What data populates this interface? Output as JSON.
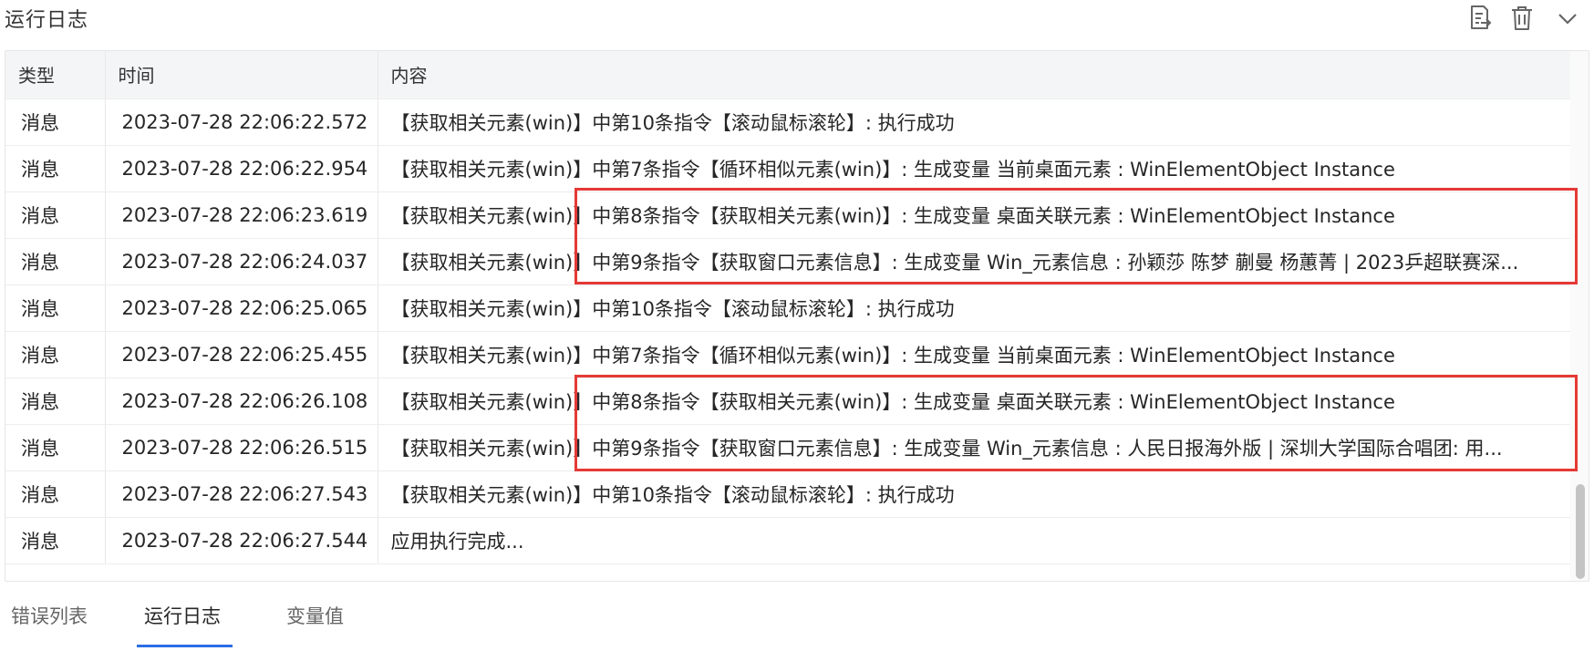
{
  "panel": {
    "title": "运行日志",
    "icons": {
      "export": "export-log-icon",
      "delete": "trash-icon",
      "collapse": "chevron-down-icon"
    }
  },
  "table": {
    "headers": {
      "type": "类型",
      "time": "时间",
      "content": "内容"
    },
    "rows": [
      {
        "type": "消息",
        "time": "2023-07-28 22:06:22.572",
        "content": "【获取相关元素(win)】中第10条指令【滚动鼠标滚轮】: 执行成功"
      },
      {
        "type": "消息",
        "time": "2023-07-28 22:06:22.954",
        "content": "【获取相关元素(win)】中第7条指令【循环相似元素(win)】: 生成变量 当前桌面元素 : WinElementObject Instance"
      },
      {
        "type": "消息",
        "time": "2023-07-28 22:06:23.619",
        "content": "【获取相关元素(win)】中第8条指令【获取相关元素(win)】: 生成变量 桌面关联元素 : WinElementObject Instance"
      },
      {
        "type": "消息",
        "time": "2023-07-28 22:06:24.037",
        "content": "【获取相关元素(win)】中第9条指令【获取窗口元素信息】: 生成变量 Win_元素信息 : 孙颖莎 陈梦 蒯曼 杨蕙菁 | 2023乒超联赛深..."
      },
      {
        "type": "消息",
        "time": "2023-07-28 22:06:25.065",
        "content": "【获取相关元素(win)】中第10条指令【滚动鼠标滚轮】: 执行成功"
      },
      {
        "type": "消息",
        "time": "2023-07-28 22:06:25.455",
        "content": "【获取相关元素(win)】中第7条指令【循环相似元素(win)】: 生成变量 当前桌面元素 : WinElementObject Instance"
      },
      {
        "type": "消息",
        "time": "2023-07-28 22:06:26.108",
        "content": "【获取相关元素(win)】中第8条指令【获取相关元素(win)】: 生成变量 桌面关联元素 : WinElementObject Instance"
      },
      {
        "type": "消息",
        "time": "2023-07-28 22:06:26.515",
        "content": "【获取相关元素(win)】中第9条指令【获取窗口元素信息】: 生成变量 Win_元素信息 : 人民日报海外版 | 深圳大学国际合唱团:  用..."
      },
      {
        "type": "消息",
        "time": "2023-07-28 22:06:27.543",
        "content": "【获取相关元素(win)】中第10条指令【滚动鼠标滚轮】: 执行成功"
      },
      {
        "type": "消息",
        "time": "2023-07-28 22:06:27.544",
        "content": "应用执行完成..."
      }
    ]
  },
  "tabs": [
    {
      "label": "错误列表",
      "active": false
    },
    {
      "label": "运行日志",
      "active": true
    },
    {
      "label": "变量值",
      "active": false
    }
  ],
  "colors": {
    "highlight": "#e53935",
    "active_tab": "#2b6ee6",
    "header_bg": "#f4f5f7"
  }
}
